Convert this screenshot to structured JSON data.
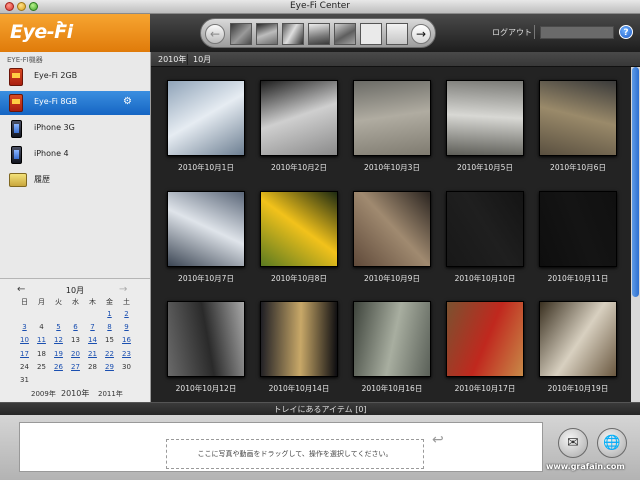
{
  "window": {
    "title": "Eye-Fi Center"
  },
  "header": {
    "logo": "Eye-Fi",
    "logout_label": "ログアウト",
    "help_label": "?"
  },
  "sidebar": {
    "section_label": "EYE-FI機器",
    "devices": [
      {
        "label": "Eye-Fi 2GB",
        "icon": "eyefi-card-icon",
        "selected": false
      },
      {
        "label": "Eye-Fi 8GB",
        "icon": "eyefi-card-icon",
        "selected": true
      },
      {
        "label": "iPhone 3G",
        "icon": "iphone-icon",
        "selected": false
      },
      {
        "label": "iPhone 4",
        "icon": "iphone-icon",
        "selected": false
      },
      {
        "label": "履歴",
        "icon": "history-icon",
        "selected": false
      }
    ]
  },
  "calendar": {
    "month_label": "10月",
    "weekdays": [
      "日",
      "月",
      "火",
      "水",
      "木",
      "金",
      "土"
    ],
    "weeks": [
      [
        "",
        "",
        "",
        "",
        "",
        "1",
        "2"
      ],
      [
        "3",
        "4",
        "5",
        "6",
        "7",
        "8",
        "9"
      ],
      [
        "10",
        "11",
        "12",
        "13",
        "14",
        "15",
        "16"
      ],
      [
        "17",
        "18",
        "19",
        "20",
        "21",
        "22",
        "23"
      ],
      [
        "24",
        "25",
        "26",
        "27",
        "28",
        "29",
        "30"
      ],
      [
        "31",
        "",
        "",
        "",
        "",
        "",
        ""
      ]
    ],
    "days_with_photos": [
      "1",
      "2",
      "3",
      "5",
      "6",
      "7",
      "8",
      "9",
      "10",
      "11",
      "12",
      "14",
      "16",
      "17",
      "19",
      "20",
      "21",
      "22",
      "23",
      "26",
      "27",
      "29"
    ],
    "years": {
      "prev": "2009年",
      "current": "2010年",
      "next": "2011年"
    }
  },
  "breadcrumb": {
    "year": "2010年",
    "month": "10月"
  },
  "photos": [
    {
      "date": "2010年10月1日",
      "colors": [
        "#8fa3b8",
        "#e6ecf2",
        "#6d7f92"
      ]
    },
    {
      "date": "2010年10月2日",
      "colors": [
        "#1e1e1e",
        "#cfcfcf",
        "#8a8a8a"
      ]
    },
    {
      "date": "2010年10月3日",
      "colors": [
        "#6b6b66",
        "#b0aca1",
        "#7f7b70"
      ]
    },
    {
      "date": "2010年10月5日",
      "colors": [
        "#7a7a76",
        "#d8d8d4",
        "#5e5e58"
      ]
    },
    {
      "date": "2010年10月6日",
      "colors": [
        "#3a3a3a",
        "#9a8a6a",
        "#5a5040"
      ]
    },
    {
      "date": "2010年10月7日",
      "colors": [
        "#5a6678",
        "#dfe4ea",
        "#3c4654"
      ]
    },
    {
      "date": "2010年10月8日",
      "colors": [
        "#1d2a12",
        "#f2c21b",
        "#5a7a20"
      ]
    },
    {
      "date": "2010年10月9日",
      "colors": [
        "#2a2420",
        "#a08a70",
        "#604a3a"
      ]
    },
    {
      "date": "2010年10月10日",
      "colors": [
        "#141414",
        "#1f1f1f",
        "#181818"
      ]
    },
    {
      "date": "2010年10月11日",
      "colors": [
        "#101010",
        "#141414",
        "#0e0e0e"
      ]
    },
    {
      "date": "2010年10月12日",
      "colors": [
        "#a8a8a8",
        "#2a2a2a",
        "#6a6a6a"
      ]
    },
    {
      "date": "2010年10月14日",
      "colors": [
        "#0c0c10",
        "#c8a868",
        "#1e1e24"
      ]
    },
    {
      "date": "2010年10月16日",
      "colors": [
        "#5a6058",
        "#a8aea0",
        "#3e443c"
      ]
    },
    {
      "date": "2010年10月17日",
      "colors": [
        "#c88a48",
        "#c0281e",
        "#7a5230"
      ]
    },
    {
      "date": "2010年10月19日",
      "colors": [
        "#6a5840",
        "#d8d0c0",
        "#3a3020"
      ]
    }
  ],
  "tray": {
    "label": "トレイにあるアイテム [0]",
    "drop_text": "ここに写真や動画をドラッグして、操作を選択してください。"
  },
  "watermark": "www.grafain.com"
}
